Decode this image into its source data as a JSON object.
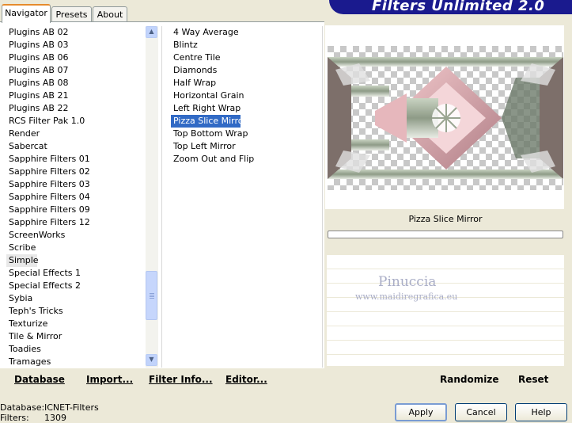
{
  "tabs": [
    "Navigator",
    "Presets",
    "About"
  ],
  "app_title": "Filters Unlimited 2.0",
  "categories": [
    "Plugins AB 02",
    "Plugins AB 03",
    "Plugins AB 06",
    "Plugins AB 07",
    "Plugins AB 08",
    "Plugins AB 21",
    "Plugins AB 22",
    "RCS Filter Pak 1.0",
    "Render",
    "Sabercat",
    "Sapphire Filters 01",
    "Sapphire Filters 02",
    "Sapphire Filters 03",
    "Sapphire Filters 04",
    "Sapphire Filters 09",
    "Sapphire Filters 12",
    "ScreenWorks",
    "Scribe",
    "Simple",
    "Special Effects 1",
    "Special Effects 2",
    "Sybia",
    "Teph's Tricks",
    "Texturize",
    "Tile & Mirror",
    "Toadies",
    "Tramages"
  ],
  "selected_category": "Simple",
  "filters": [
    "4 Way Average",
    "Blintz",
    "Centre Tile",
    "Diamonds",
    "Half Wrap",
    "Horizontal Grain",
    "Left Right Wrap",
    "Pizza Slice Mirror",
    "Top Bottom Wrap",
    "Top Left Mirror",
    "Zoom Out and Flip"
  ],
  "selected_filter": "Pizza Slice Mirror",
  "preview": {
    "filter_name": "Pizza Slice Mirror"
  },
  "watermark": {
    "name": "Pinuccia",
    "site": "www.maidiregrafica.eu"
  },
  "bottom_links": {
    "database": "Database",
    "import": "Import...",
    "filter_info": "Filter Info...",
    "editor": "Editor..."
  },
  "right_links": {
    "randomize": "Randomize",
    "reset": "Reset"
  },
  "status": {
    "database_label": "Database:",
    "database_value": "ICNET-Filters",
    "filters_label": "Filters:",
    "filters_value": "1309"
  },
  "buttons": {
    "apply": "Apply",
    "cancel": "Cancel",
    "help": "Help"
  },
  "colors": {
    "selection": "#316ac5",
    "banner": "#1a1a8e",
    "tab_accent": "#e68b2c"
  }
}
